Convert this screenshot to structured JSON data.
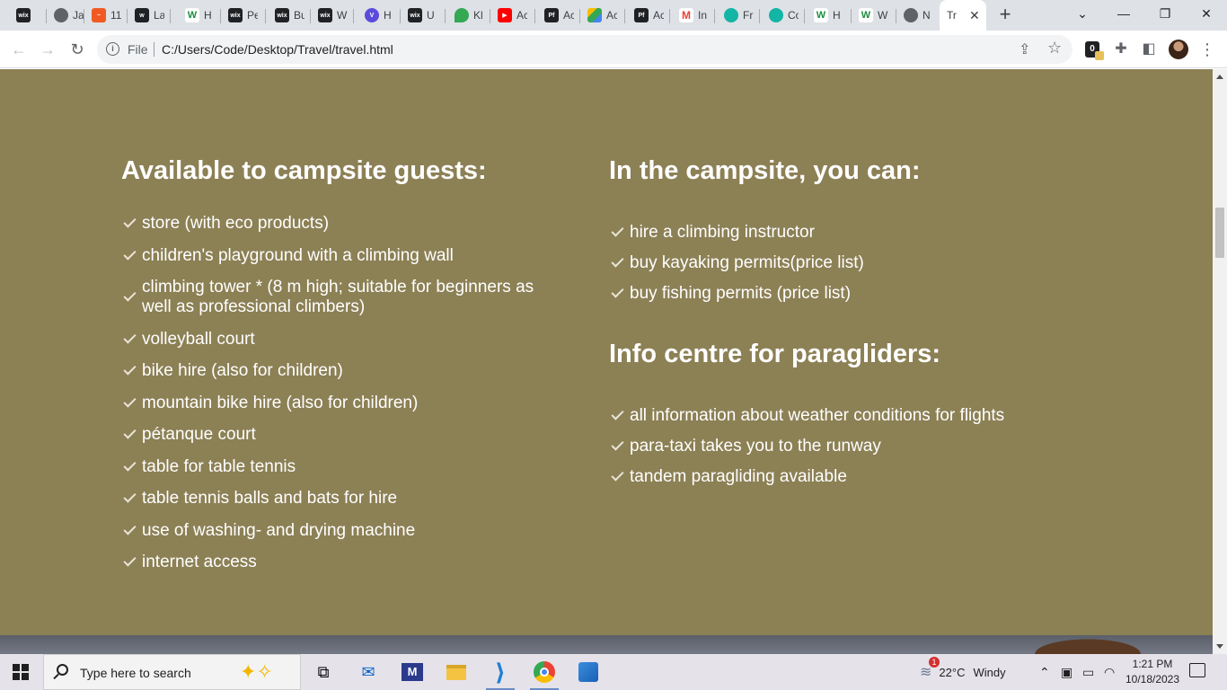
{
  "browser": {
    "tabs": [
      {
        "title": "Ja"
      },
      {
        "title": "11"
      },
      {
        "title": "La"
      },
      {
        "title": "H"
      },
      {
        "title": "Pe"
      },
      {
        "title": "Bu"
      },
      {
        "title": "W"
      },
      {
        "title": "H"
      },
      {
        "title": "U"
      },
      {
        "title": "Kl"
      },
      {
        "title": "Ac"
      },
      {
        "title": "Ac"
      },
      {
        "title": "Ac"
      },
      {
        "title": "Ac"
      },
      {
        "title": "In"
      },
      {
        "title": "Fr"
      },
      {
        "title": "Co"
      },
      {
        "title": "H"
      },
      {
        "title": "W"
      },
      {
        "title": "N"
      }
    ],
    "first_tab_title": "",
    "active_tab_title": "Tr",
    "address": {
      "scheme_label": "File",
      "url": "C:/Users/Code/Desktop/Travel/travel.html"
    }
  },
  "page": {
    "left": {
      "heading": "Available to campsite guests:",
      "items": [
        "store (with eco products)",
        "children's playground with a climbing wall",
        "climbing tower * (8 m high; suitable for beginners as well as professional climbers)",
        "volleyball court",
        "bike hire (also for children)",
        "mountain bike hire (also for children)",
        "pétanque court",
        "table for table tennis",
        "table tennis balls and bats for hire",
        "use of washing- and drying machine",
        "internet access"
      ]
    },
    "right": {
      "heading_a": "In the campsite, you can:",
      "items_a": [
        "hire a climbing instructor",
        "buy kayaking permits(price list)",
        "buy fishing permits (price list)"
      ],
      "heading_b": "Info centre for paragliders:",
      "items_b": [
        "all information about weather conditions for flights",
        "para-taxi takes you to the runway",
        "tandem paragliding available"
      ]
    },
    "colors": {
      "section_bg": "#8c8055",
      "text": "#ffffff"
    }
  },
  "taskbar": {
    "search_placeholder": "Type here to search",
    "weather_temp": "22°C",
    "weather_desc": "Windy",
    "weather_badge": "1",
    "time": "1:21 PM",
    "date": "10/18/2023",
    "apps": [
      "task-view",
      "mail",
      "pen-app",
      "file-explorer",
      "vscode",
      "chrome",
      "photos"
    ]
  }
}
